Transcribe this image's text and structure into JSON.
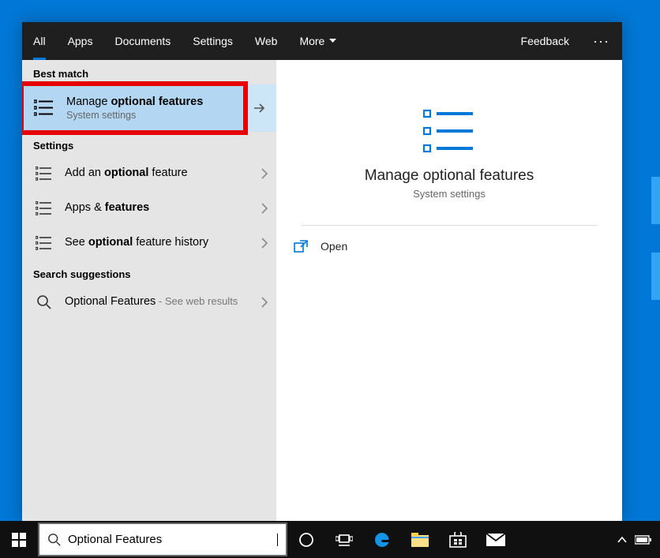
{
  "tabs": {
    "all": "All",
    "apps": "Apps",
    "documents": "Documents",
    "settings": "Settings",
    "web": "Web",
    "more": "More",
    "feedback": "Feedback"
  },
  "sections": {
    "best_match": "Best match",
    "settings": "Settings",
    "suggestions": "Search suggestions"
  },
  "best_match": {
    "title_pre": "Manage ",
    "title_bold": "optional features",
    "subtitle": "System settings"
  },
  "settings_results": [
    {
      "pre": "Add an ",
      "bold": "optional",
      "post": " feature"
    },
    {
      "pre": "Apps & ",
      "bold": "features",
      "post": ""
    },
    {
      "pre": "See ",
      "bold": "optional",
      "post": " feature history"
    }
  ],
  "suggestion": {
    "title": "Optional Features",
    "suffix": " - See web results"
  },
  "preview": {
    "title": "Manage optional features",
    "subtitle": "System settings",
    "open": "Open"
  },
  "search": {
    "value": "Optional Features"
  }
}
